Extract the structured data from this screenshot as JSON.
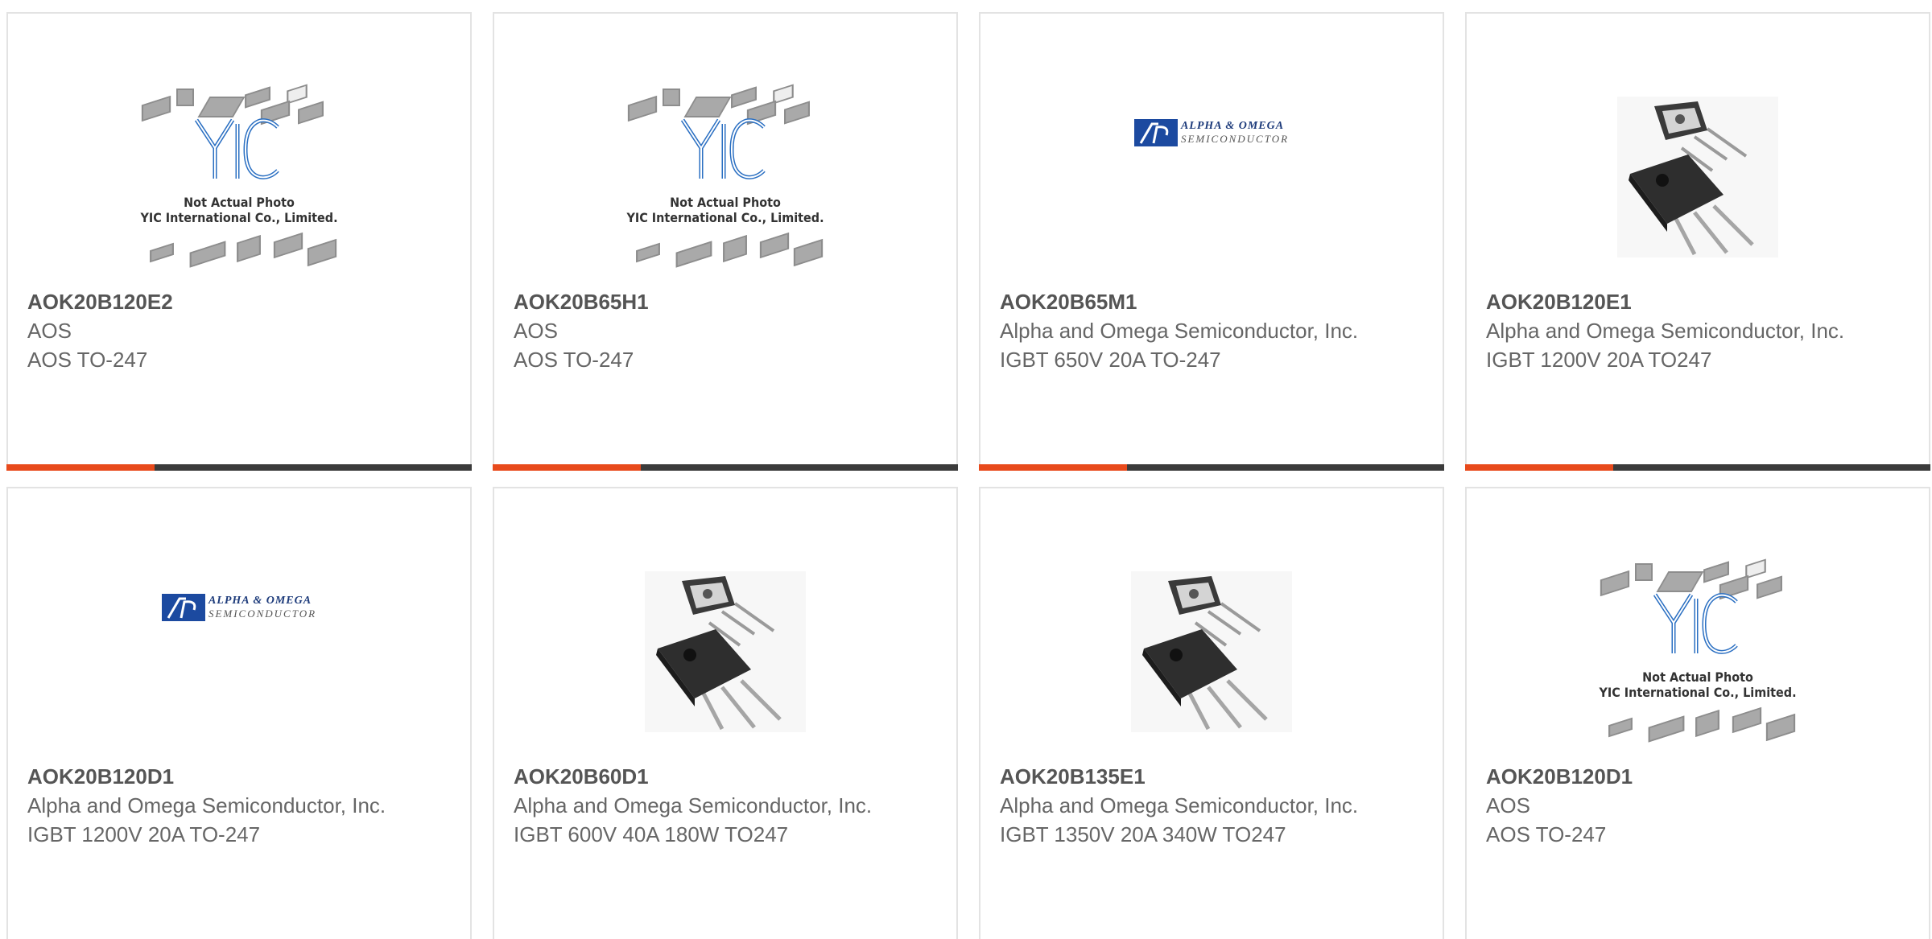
{
  "products": [
    {
      "part": "AOK20B120E2",
      "maker": "AOS",
      "desc": "AOS TO-247",
      "image": "yic-placeholder"
    },
    {
      "part": "AOK20B65H1",
      "maker": "AOS",
      "desc": "AOS TO-247",
      "image": "yic-placeholder"
    },
    {
      "part": "AOK20B65M1",
      "maker": "Alpha and Omega Semiconductor, Inc.",
      "desc": "IGBT 650V 20A TO-247",
      "image": "aos-logo"
    },
    {
      "part": "AOK20B120E1",
      "maker": "Alpha and Omega Semiconductor, Inc.",
      "desc": "IGBT 1200V 20A TO247",
      "image": "to247-photo"
    },
    {
      "part": "AOK20B120D1",
      "maker": "Alpha and Omega Semiconductor, Inc.",
      "desc": "IGBT 1200V 20A TO-247",
      "image": "aos-logo"
    },
    {
      "part": "AOK20B60D1",
      "maker": "Alpha and Omega Semiconductor, Inc.",
      "desc": "IGBT 600V 40A 180W TO247",
      "image": "to247-photo"
    },
    {
      "part": "AOK20B135E1",
      "maker": "Alpha and Omega Semiconductor, Inc.",
      "desc": "IGBT 1350V 20A 340W TO247",
      "image": "to247-photo"
    },
    {
      "part": "AOK20B120D1",
      "maker": "AOS",
      "desc": "AOS TO-247",
      "image": "yic-placeholder"
    }
  ],
  "placeholder": {
    "line1": "Not Actual Photo",
    "line2": "YIC International Co., Limited."
  },
  "aos_logo": {
    "line1": "ALPHA & OMEGA",
    "line2": "SEMICONDUCTOR"
  },
  "colors": {
    "accent": "#e84a1c",
    "bar_dark": "#3b3b3b",
    "border": "#e3e3e3"
  }
}
